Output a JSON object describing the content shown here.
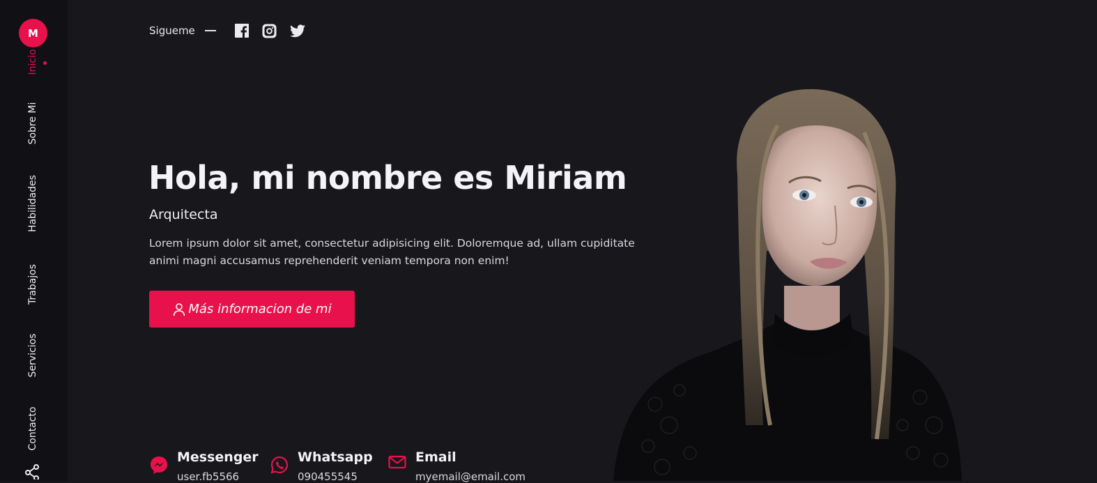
{
  "sidebar": {
    "logo_letter": "M",
    "items": [
      {
        "label": "Inicio"
      },
      {
        "label": "Sobre Mi"
      },
      {
        "label": "Habilidades"
      },
      {
        "label": "Trabajos"
      },
      {
        "label": "Servicios"
      },
      {
        "label": "Contacto"
      }
    ],
    "bottom_icon": "share-icon"
  },
  "follow": {
    "label": "Sigueme",
    "networks": [
      "facebook-icon",
      "instagram-icon",
      "twitter-icon"
    ]
  },
  "hero": {
    "title": "Hola, mi nombre es Miriam",
    "subtitle": "Arquitecta",
    "description": "Lorem ipsum dolor sit amet, consectetur adipisicing elit. Doloremque ad, ullam cupiditate animi magni accusamus reprehenderit veniam tempora non enim!",
    "button_label": "Más informacion de mi",
    "button_icon": "user-icon"
  },
  "contacts": [
    {
      "label": "Messenger",
      "value": "user.fb5566",
      "icon": "messenger-icon"
    },
    {
      "label": "Whatsapp",
      "value": "090455545",
      "icon": "whatsapp-icon"
    },
    {
      "label": "Email",
      "value": "myemail@email.com",
      "icon": "mail-icon"
    }
  ],
  "colors": {
    "accent": "#e8114b",
    "background": "#17171c",
    "sidebar": "#101015",
    "text": "#f2f2f5"
  }
}
